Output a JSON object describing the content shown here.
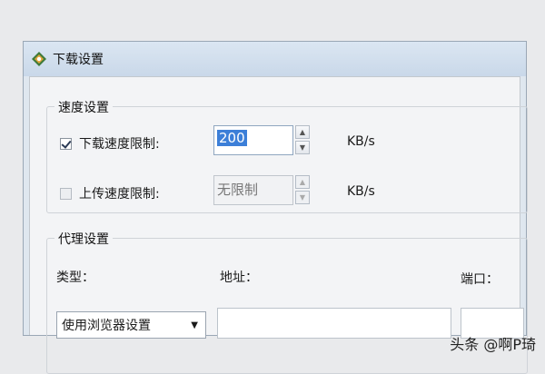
{
  "window": {
    "title": "下载设置"
  },
  "speed": {
    "group_label": "速度设置",
    "download_limit": {
      "label": "下载速度限制:",
      "checked": true,
      "value": "200",
      "unit": "KB/s"
    },
    "upload_limit": {
      "label": "上传速度限制:",
      "checked": false,
      "value": "无限制",
      "unit": "KB/s"
    }
  },
  "proxy": {
    "group_label": "代理设置",
    "type_label": "类型：",
    "address_label": "地址：",
    "port_label": "端口：",
    "type_value": "使用浏览器设置"
  },
  "watermark": "头条 @啊P琦",
  "colors": {
    "selection": "#3c7fd8",
    "titlebar": "#c9d8e9"
  }
}
